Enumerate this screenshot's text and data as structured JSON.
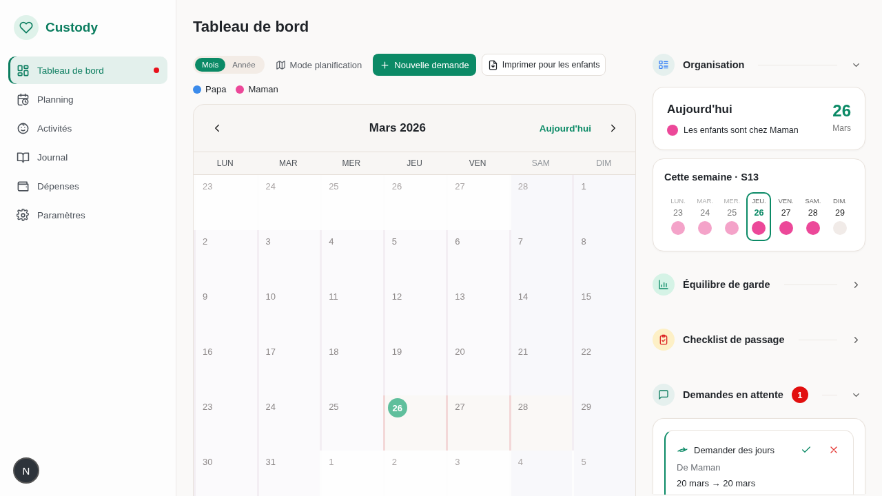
{
  "app": {
    "name": "Custody"
  },
  "sidebar": {
    "items": [
      {
        "label": "Tableau de bord",
        "selected": true,
        "notification": true
      },
      {
        "label": "Planning",
        "selected": false,
        "notification": false
      },
      {
        "label": "Activités",
        "selected": false,
        "notification": false
      },
      {
        "label": "Journal",
        "selected": false,
        "notification": false
      },
      {
        "label": "Dépenses",
        "selected": false,
        "notification": false
      },
      {
        "label": "Paramètres",
        "selected": false,
        "notification": false
      }
    ]
  },
  "avatar": {
    "initial": "N"
  },
  "page": {
    "title": "Tableau de bord"
  },
  "toolbar": {
    "view_toggle": [
      {
        "label": "Mois",
        "selected": true
      },
      {
        "label": "Année",
        "selected": false
      }
    ],
    "planning_mode": "Mode planification",
    "new_request": "Nouvelle demande",
    "print": "Imprimer pour les enfants"
  },
  "legend": [
    {
      "label": "Papa",
      "color": "#3b8beb"
    },
    {
      "label": "Maman",
      "color": "#ec4899"
    }
  ],
  "calendar": {
    "month": "Mars 2026",
    "today_button": "Aujourd'hui",
    "weekdays": [
      {
        "label": "LUN",
        "weekend": false
      },
      {
        "label": "MAR",
        "weekend": false
      },
      {
        "label": "MER",
        "weekend": false
      },
      {
        "label": "JEU",
        "weekend": false
      },
      {
        "label": "VEN",
        "weekend": false
      },
      {
        "label": "SAM",
        "weekend": true
      },
      {
        "label": "DIM",
        "weekend": true
      }
    ],
    "weeks": [
      [
        {
          "day": "23",
          "outside": true,
          "today": false
        },
        {
          "day": "24",
          "outside": true,
          "today": false
        },
        {
          "day": "25",
          "outside": true,
          "today": false
        },
        {
          "day": "26",
          "outside": true,
          "today": false
        },
        {
          "day": "27",
          "outside": true,
          "today": false
        },
        {
          "day": "28",
          "outside": true,
          "today": false
        },
        {
          "day": "1",
          "outside": false,
          "today": false
        }
      ],
      [
        {
          "day": "2",
          "outside": false,
          "today": false
        },
        {
          "day": "3",
          "outside": false,
          "today": false
        },
        {
          "day": "4",
          "outside": false,
          "today": false
        },
        {
          "day": "5",
          "outside": false,
          "today": false
        },
        {
          "day": "6",
          "outside": false,
          "today": false
        },
        {
          "day": "7",
          "outside": false,
          "today": false
        },
        {
          "day": "8",
          "outside": false,
          "today": false
        }
      ],
      [
        {
          "day": "9",
          "outside": false,
          "today": false
        },
        {
          "day": "10",
          "outside": false,
          "today": false
        },
        {
          "day": "11",
          "outside": false,
          "today": false
        },
        {
          "day": "12",
          "outside": false,
          "today": false
        },
        {
          "day": "13",
          "outside": false,
          "today": false
        },
        {
          "day": "14",
          "outside": false,
          "today": false
        },
        {
          "day": "15",
          "outside": false,
          "today": false
        }
      ],
      [
        {
          "day": "16",
          "outside": false,
          "today": false
        },
        {
          "day": "17",
          "outside": false,
          "today": false
        },
        {
          "day": "18",
          "outside": false,
          "today": false
        },
        {
          "day": "19",
          "outside": false,
          "today": false
        },
        {
          "day": "20",
          "outside": false,
          "today": false
        },
        {
          "day": "21",
          "outside": false,
          "today": false
        },
        {
          "day": "22",
          "outside": false,
          "today": false
        }
      ],
      [
        {
          "day": "23",
          "outside": false,
          "today": false
        },
        {
          "day": "24",
          "outside": false,
          "today": false
        },
        {
          "day": "25",
          "outside": false,
          "today": false
        },
        {
          "day": "26",
          "outside": false,
          "today": true
        },
        {
          "day": "27",
          "outside": false,
          "today": false
        },
        {
          "day": "28",
          "outside": false,
          "today": false
        },
        {
          "day": "29",
          "outside": false,
          "today": false
        }
      ],
      [
        {
          "day": "30",
          "outside": false,
          "today": false
        },
        {
          "day": "31",
          "outside": false,
          "today": false
        },
        {
          "day": "1",
          "outside": true,
          "today": false
        },
        {
          "day": "2",
          "outside": true,
          "today": false
        },
        {
          "day": "3",
          "outside": true,
          "today": false
        },
        {
          "day": "4",
          "outside": true,
          "today": false
        },
        {
          "day": "5",
          "outside": true,
          "today": false
        }
      ]
    ]
  },
  "organisation": {
    "title": "Organisation",
    "expanded": true,
    "today_card": {
      "title": "Aujourd'hui",
      "status": "Les enfants sont chez Maman",
      "day": "26",
      "month": "Mars"
    },
    "week_card": {
      "title": "Cette semaine · S13",
      "days": [
        {
          "weekday": "LUN.",
          "day": "23",
          "color": "#f4a3c9",
          "selected": false,
          "past": true
        },
        {
          "weekday": "MAR.",
          "day": "24",
          "color": "#f4a3c9",
          "selected": false,
          "past": true
        },
        {
          "weekday": "MER.",
          "day": "25",
          "color": "#f4a3c9",
          "selected": false,
          "past": true
        },
        {
          "weekday": "JEU.",
          "day": "26",
          "color": "#ec4899",
          "selected": true,
          "past": false
        },
        {
          "weekday": "VEN.",
          "day": "27",
          "color": "#ec4899",
          "selected": false,
          "past": false
        },
        {
          "weekday": "SAM.",
          "day": "28",
          "color": "#ec4899",
          "selected": false,
          "past": false
        },
        {
          "weekday": "DIM.",
          "day": "29",
          "color": "#f1ebe8",
          "selected": false,
          "past": false
        }
      ]
    }
  },
  "sections": [
    {
      "title": "Équilibre de garde",
      "expanded": false
    },
    {
      "title": "Checklist de passage",
      "expanded": false
    },
    {
      "title": "Demandes en attente",
      "expanded": true,
      "badge": "1"
    }
  ],
  "requests": [
    {
      "type": "Demander des jours",
      "from": "De Maman",
      "dates": "20 mars → 20 mars"
    }
  ]
}
